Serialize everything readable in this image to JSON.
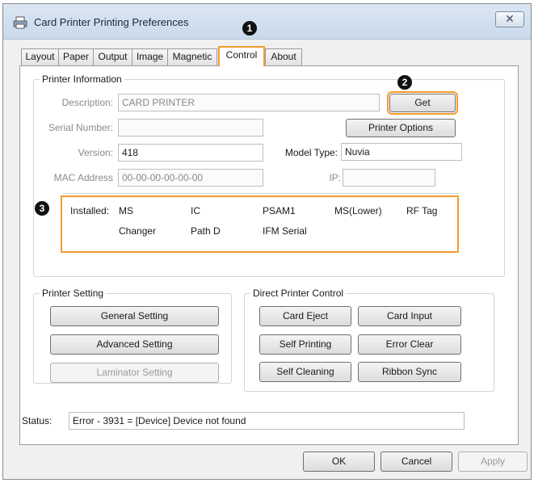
{
  "window": {
    "title": "Card Printer Printing Preferences",
    "close_label": "✕"
  },
  "tabs": [
    {
      "label": "Layout"
    },
    {
      "label": "Paper"
    },
    {
      "label": "Output"
    },
    {
      "label": "Image"
    },
    {
      "label": "Magnetic"
    },
    {
      "label": "Control",
      "active": true
    },
    {
      "label": "About"
    }
  ],
  "badges": [
    "1",
    "2",
    "3"
  ],
  "printer_info": {
    "legend": "Printer Information",
    "description_label": "Description:",
    "description_value": "CARD PRINTER",
    "serial_label": "Serial Number:",
    "serial_value": "",
    "version_label": "Version:",
    "version_value": "418",
    "mac_label": "MAC Address",
    "mac_value": "00-00-00-00-00-00",
    "model_type_label": "Model Type:",
    "model_type_value": "Nuvia",
    "ip_label": "IP:",
    "ip_value": "",
    "get_button": "Get",
    "printer_options_button": "Printer Options",
    "installed_label": "Installed:",
    "installed_row1": [
      "MS",
      "IC",
      "PSAM1",
      "MS(Lower)",
      "RF Tag"
    ],
    "installed_row2": [
      "Changer",
      "Path D",
      "IFM Serial"
    ]
  },
  "printer_setting": {
    "legend": "Printer Setting",
    "general_button": "General Setting",
    "advanced_button": "Advanced Setting",
    "laminator_button": "Laminator Setting"
  },
  "direct_control": {
    "legend": "Direct Printer Control",
    "card_eject": "Card Eject",
    "card_input": "Card Input",
    "self_printing": "Self Printing",
    "error_clear": "Error Clear",
    "self_cleaning": "Self Cleaning",
    "ribbon_sync": "Ribbon Sync"
  },
  "status": {
    "label": "Status:",
    "value": "Error - 3931 = [Device] Device not found"
  },
  "footer": {
    "ok": "OK",
    "cancel": "Cancel",
    "apply": "Apply"
  },
  "colors": {
    "highlight": "#f39c2d",
    "titlebar": "#c9d9ec"
  }
}
